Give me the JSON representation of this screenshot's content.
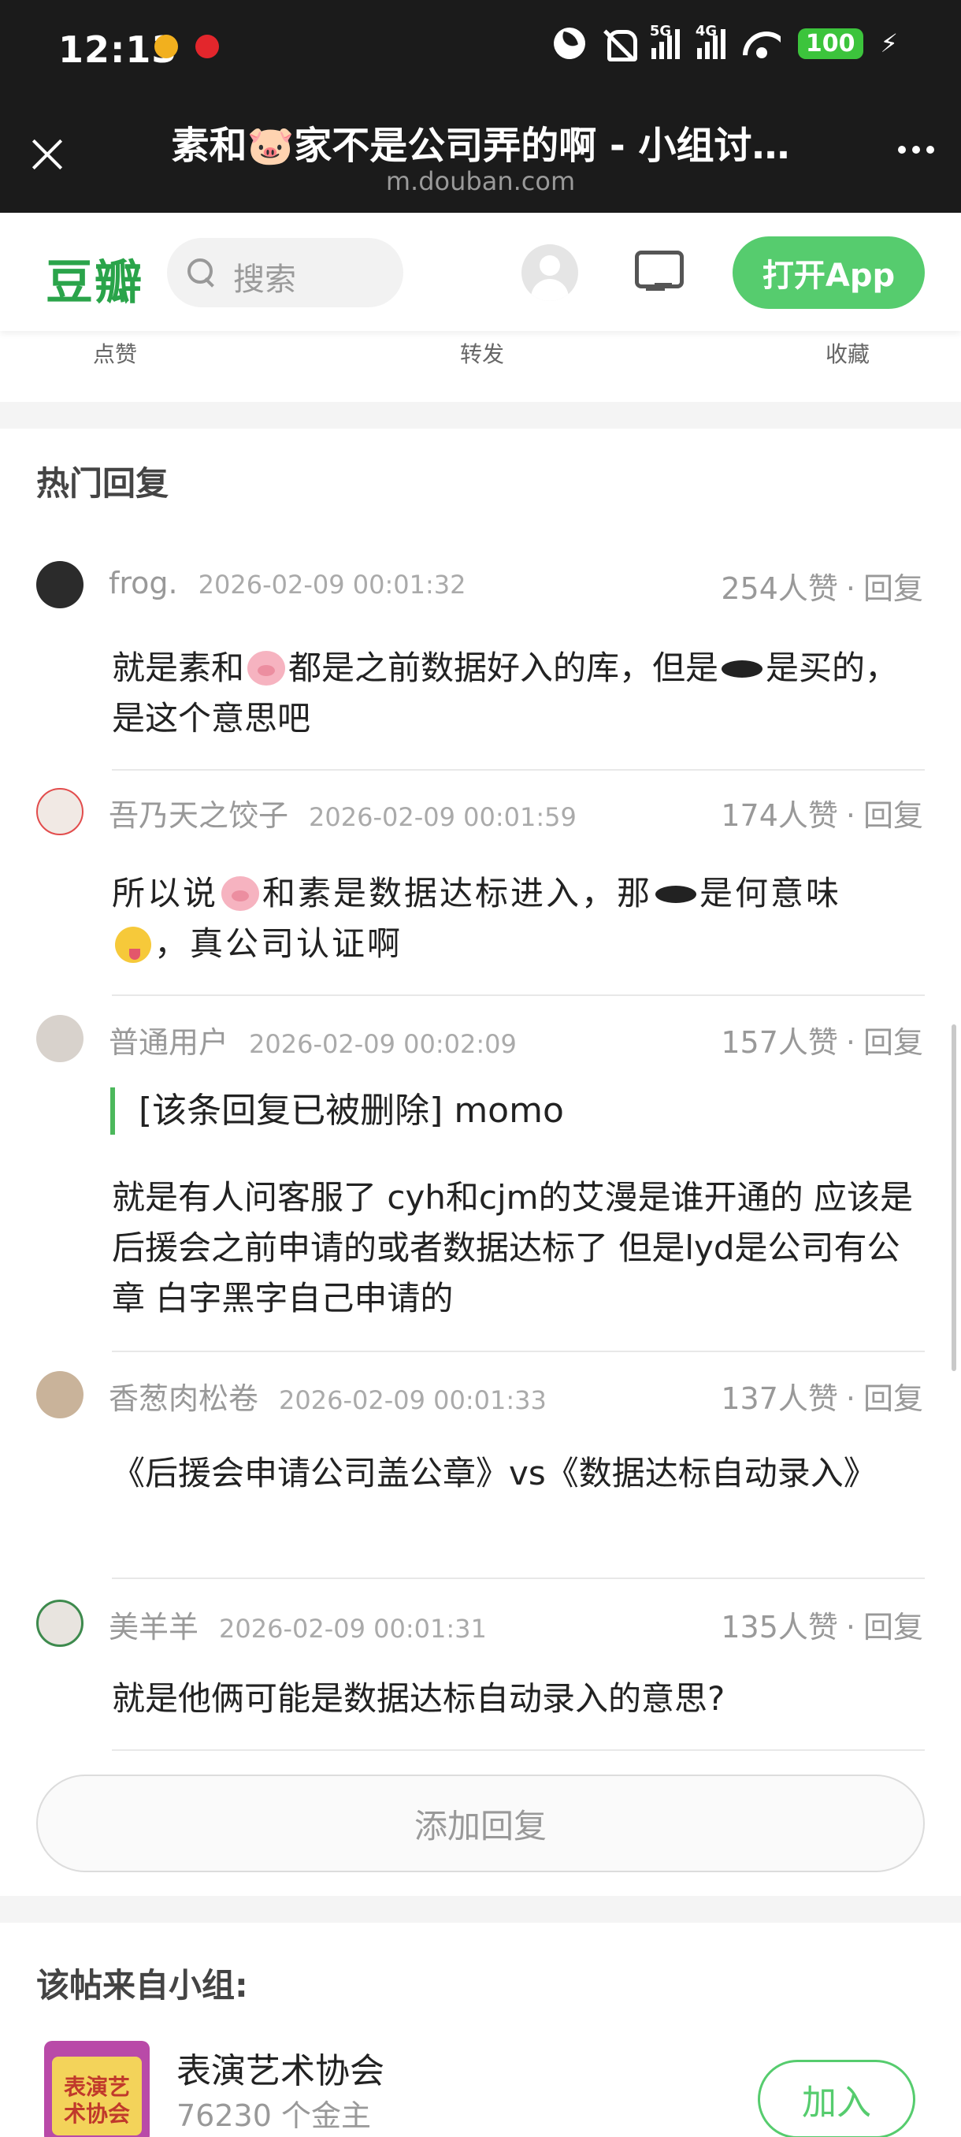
{
  "status_bar": {
    "time": "12:13",
    "network_1": "5G",
    "network_2": "4G",
    "battery": "100",
    "icons": [
      "moon-icon",
      "bell-off-icon",
      "signal-5g-icon",
      "signal-4g-icon",
      "wifi-icon",
      "battery-icon",
      "charging-icon"
    ]
  },
  "browser": {
    "title": "素和🐷家不是公司弄的啊 - 小组讨…",
    "url": "m.douban.com"
  },
  "header": {
    "logo": "豆瓣",
    "search_placeholder": "搜索",
    "open_app": "打开App",
    "brand_color": "#2aa44a",
    "button_color": "#56cc6e"
  },
  "actions": {
    "like": "点赞",
    "share": "转发",
    "collect": "收藏"
  },
  "hot_replies": {
    "title": "热门回复",
    "items": [
      {
        "name": "frog.",
        "time": "2026-02-09 00:01:32",
        "likes": "254人赞",
        "reply": "回复",
        "text_a": "就是素和",
        "text_b": "都是之前数据好入的库，但是",
        "text_c": "是买的，是这个意思吧"
      },
      {
        "name": "吾乃天之饺子",
        "time": "2026-02-09 00:01:59",
        "likes": "174人赞",
        "reply": "回复",
        "text_a": "所以说",
        "text_b": "和素是数据达标进入，那",
        "text_c": "是何意味",
        "text_d": "，真公司认证啊"
      },
      {
        "name": "普通用户",
        "time": "2026-02-09 00:02:09",
        "likes": "157人赞",
        "reply": "回复",
        "quote": "[该条回复已被删除] momo",
        "text": "就是有人问客服了 cyh和cjm的艾漫是谁开通的 应该是后援会之前申请的或者数据达标了 但是lyd是公司有公章 白字黑字自己申请的"
      },
      {
        "name": "香葱肉松卷",
        "time": "2026-02-09 00:01:33",
        "likes": "137人赞",
        "reply": "回复",
        "text": "《后援会申请公司盖公章》vs《数据达标自动录入》"
      },
      {
        "name": "美羊羊",
        "time": "2026-02-09 00:01:31",
        "likes": "135人赞",
        "reply": "回复",
        "text": "就是他俩可能是数据达标自动录入的意思?"
      }
    ]
  },
  "add_reply": "添加回复",
  "group": {
    "section_title": "该帖来自小组:",
    "cover_text": "表演艺术协会",
    "name": "表演艺术协会",
    "members": "76230 个金主",
    "join": "加入"
  }
}
